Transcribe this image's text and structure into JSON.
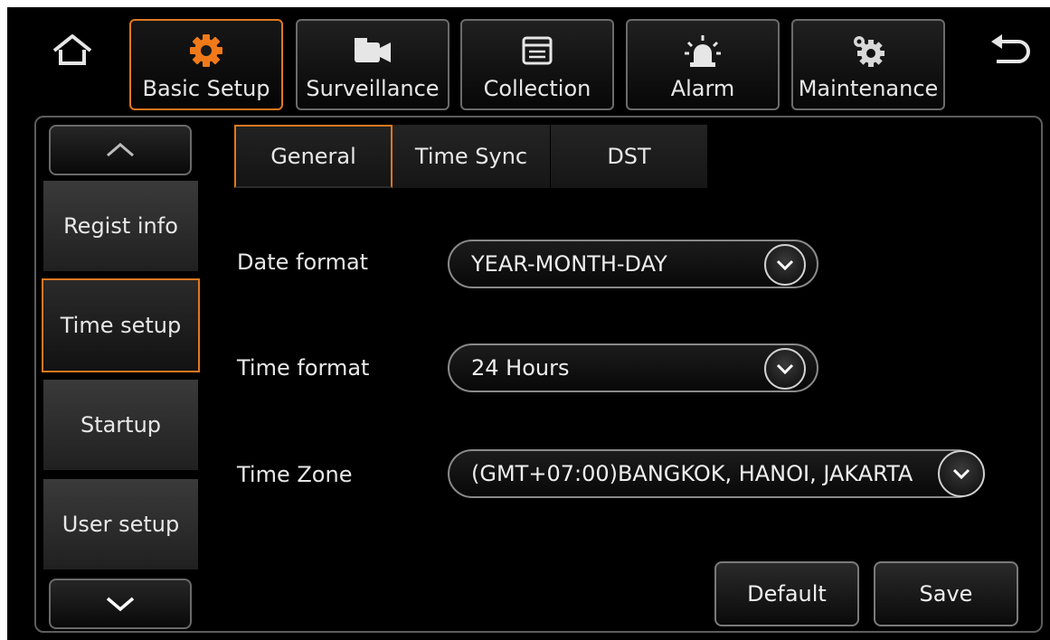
{
  "top_nav": {
    "home_icon": "home-icon",
    "back_icon": "back-arrow-icon",
    "menus": [
      {
        "label": "Basic Setup",
        "icon": "gear-icon",
        "active": true
      },
      {
        "label": "Surveillance",
        "icon": "video-camera-icon",
        "active": false
      },
      {
        "label": "Collection",
        "icon": "window-icon",
        "active": false
      },
      {
        "label": "Alarm",
        "icon": "siren-icon",
        "active": false
      },
      {
        "label": "Maintenance",
        "icon": "gears-icon",
        "active": false
      }
    ]
  },
  "sidebar": {
    "items": [
      {
        "label": "Regist info",
        "active": false
      },
      {
        "label": "Time setup",
        "active": true
      },
      {
        "label": "Startup",
        "active": false
      },
      {
        "label": "User setup",
        "active": false
      }
    ]
  },
  "tabs": [
    {
      "label": "General",
      "active": true
    },
    {
      "label": "Time Sync",
      "active": false
    },
    {
      "label": "DST",
      "active": false
    }
  ],
  "fields": {
    "date_format": {
      "label": "Date format",
      "value": "YEAR-MONTH-DAY"
    },
    "time_format": {
      "label": "Time format",
      "value": "24 Hours"
    },
    "time_zone": {
      "label": "Time Zone",
      "value": "(GMT+07:00)BANGKOK, HANOI, JAKARTA"
    }
  },
  "actions": {
    "default_label": "Default",
    "save_label": "Save"
  },
  "colors": {
    "accent": "#e0781f",
    "background": "#000000"
  }
}
